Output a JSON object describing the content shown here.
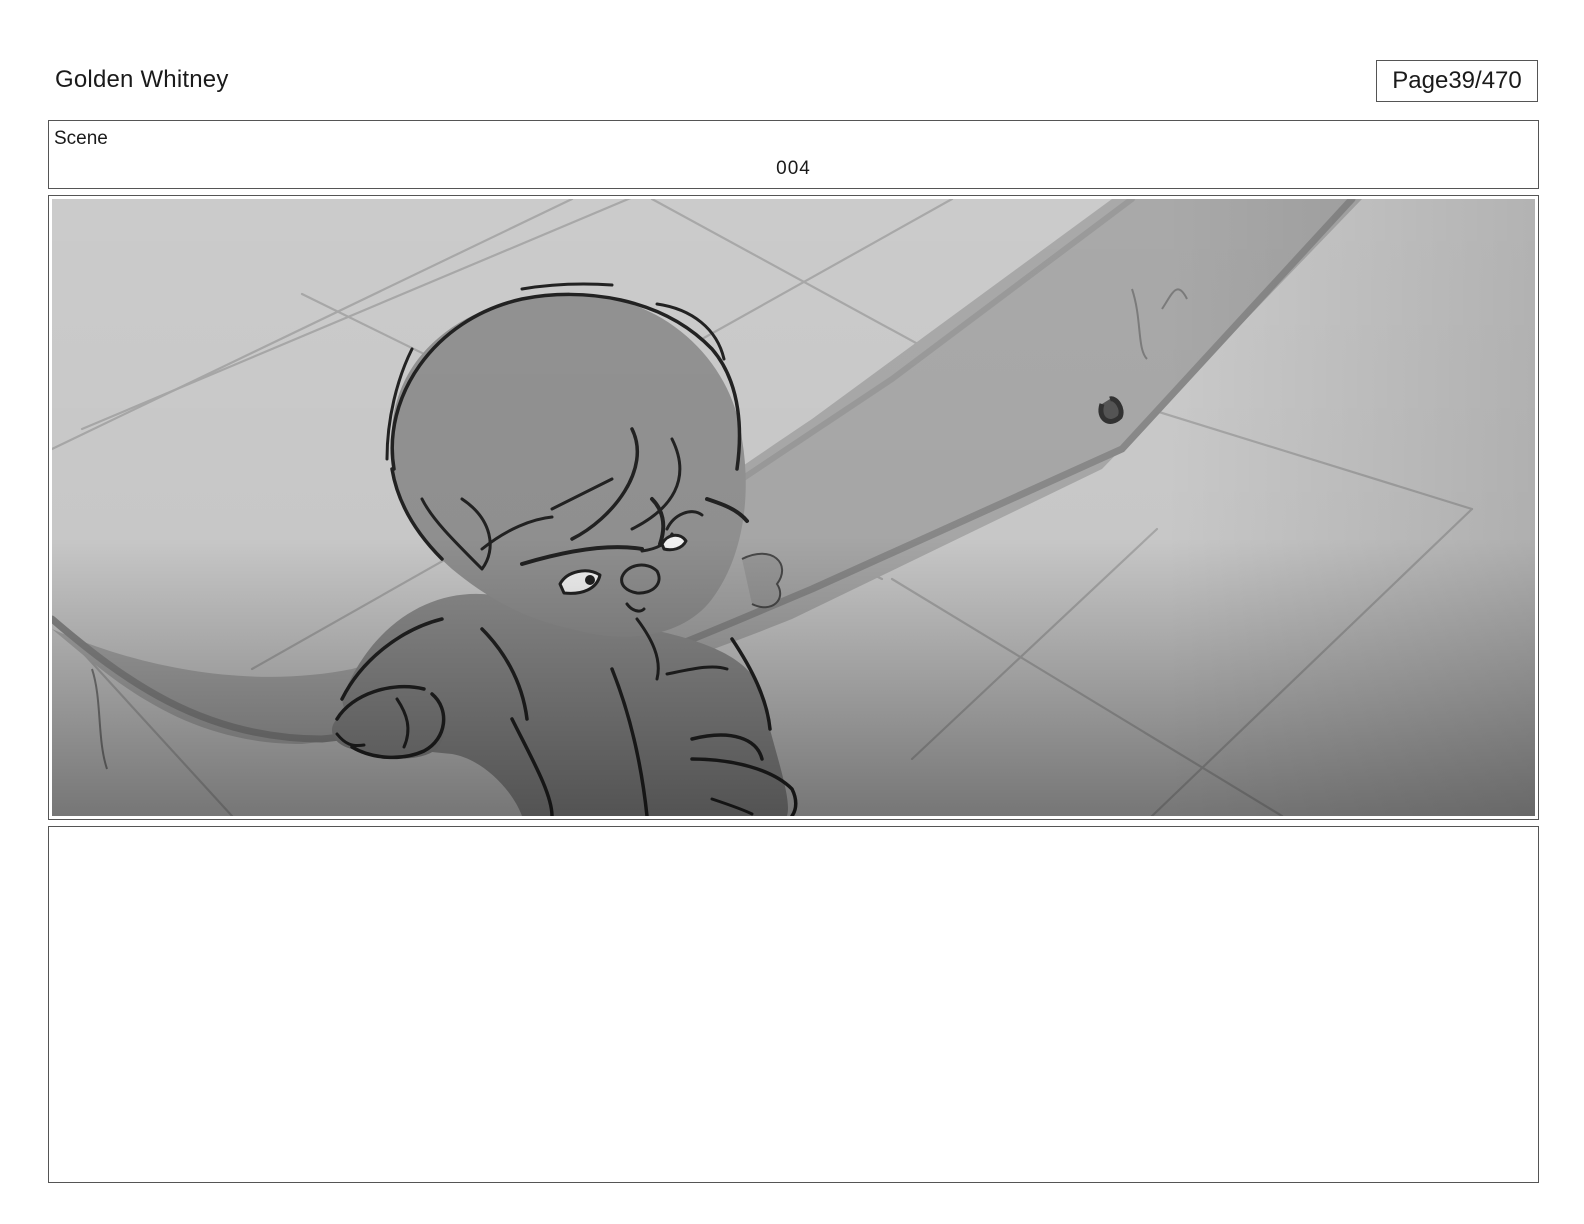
{
  "header": {
    "project_title": "Golden Whitney",
    "page_label": "Page",
    "page_number": "39/470"
  },
  "scene": {
    "label": "Scene",
    "number": "004"
  },
  "panel": {
    "image_subject": "storyboard-sketch-baby-crawling-on-plank"
  },
  "notes": {
    "text": ""
  },
  "colors": {
    "border": "#555555",
    "sketch_background": "#c9c9c9",
    "plank": "#a6a6a6",
    "figure": "#8f8f8f",
    "line": "#1e1e1e"
  }
}
